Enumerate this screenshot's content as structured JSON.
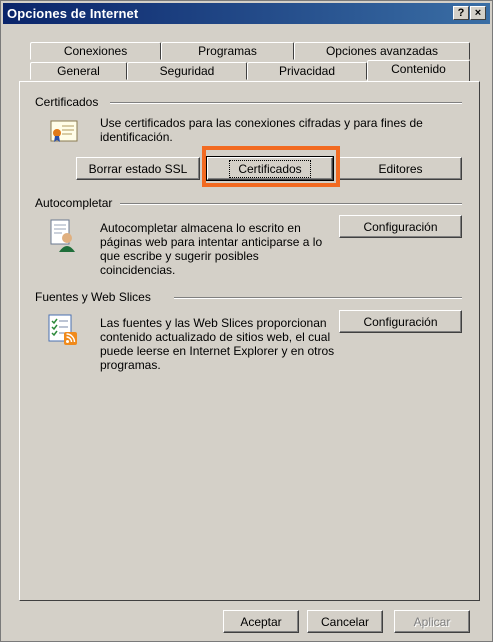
{
  "window": {
    "title": "Opciones de Internet",
    "help_button": "?",
    "close_button": "×"
  },
  "tabs_back": [
    "Conexiones",
    "Programas",
    "Opciones avanzadas"
  ],
  "tabs_front": [
    "General",
    "Seguridad",
    "Privacidad",
    "Contenido"
  ],
  "active_tab": "Contenido",
  "certificates": {
    "section_label": "Certificados",
    "description": "Use certificados para las conexiones cifradas y para fines de identificación.",
    "clear_ssl_label": "Borrar estado SSL",
    "certificates_label": "Certificados",
    "publishers_label": "Editores"
  },
  "autocomplete": {
    "section_label": "Autocompletar",
    "description": "Autocompletar almacena lo escrito en páginas web para intentar anticiparse a lo que escribe y sugerir posibles coincidencias.",
    "settings_label": "Configuración"
  },
  "feeds": {
    "section_label": "Fuentes y Web Slices",
    "description": "Las fuentes y las Web Slices proporcionan contenido actualizado de sitios web, el cual puede leerse en Internet Explorer y en otros programas.",
    "settings_label": "Configuración"
  },
  "footer": {
    "ok_label": "Aceptar",
    "cancel_label": "Cancelar",
    "apply_label": "Aplicar"
  },
  "colors": {
    "title_bar_start": "#0a246a",
    "title_bar_end": "#3a6ea5",
    "dialog_face": "#d4d0c8",
    "highlight_box": "#f26a21"
  }
}
